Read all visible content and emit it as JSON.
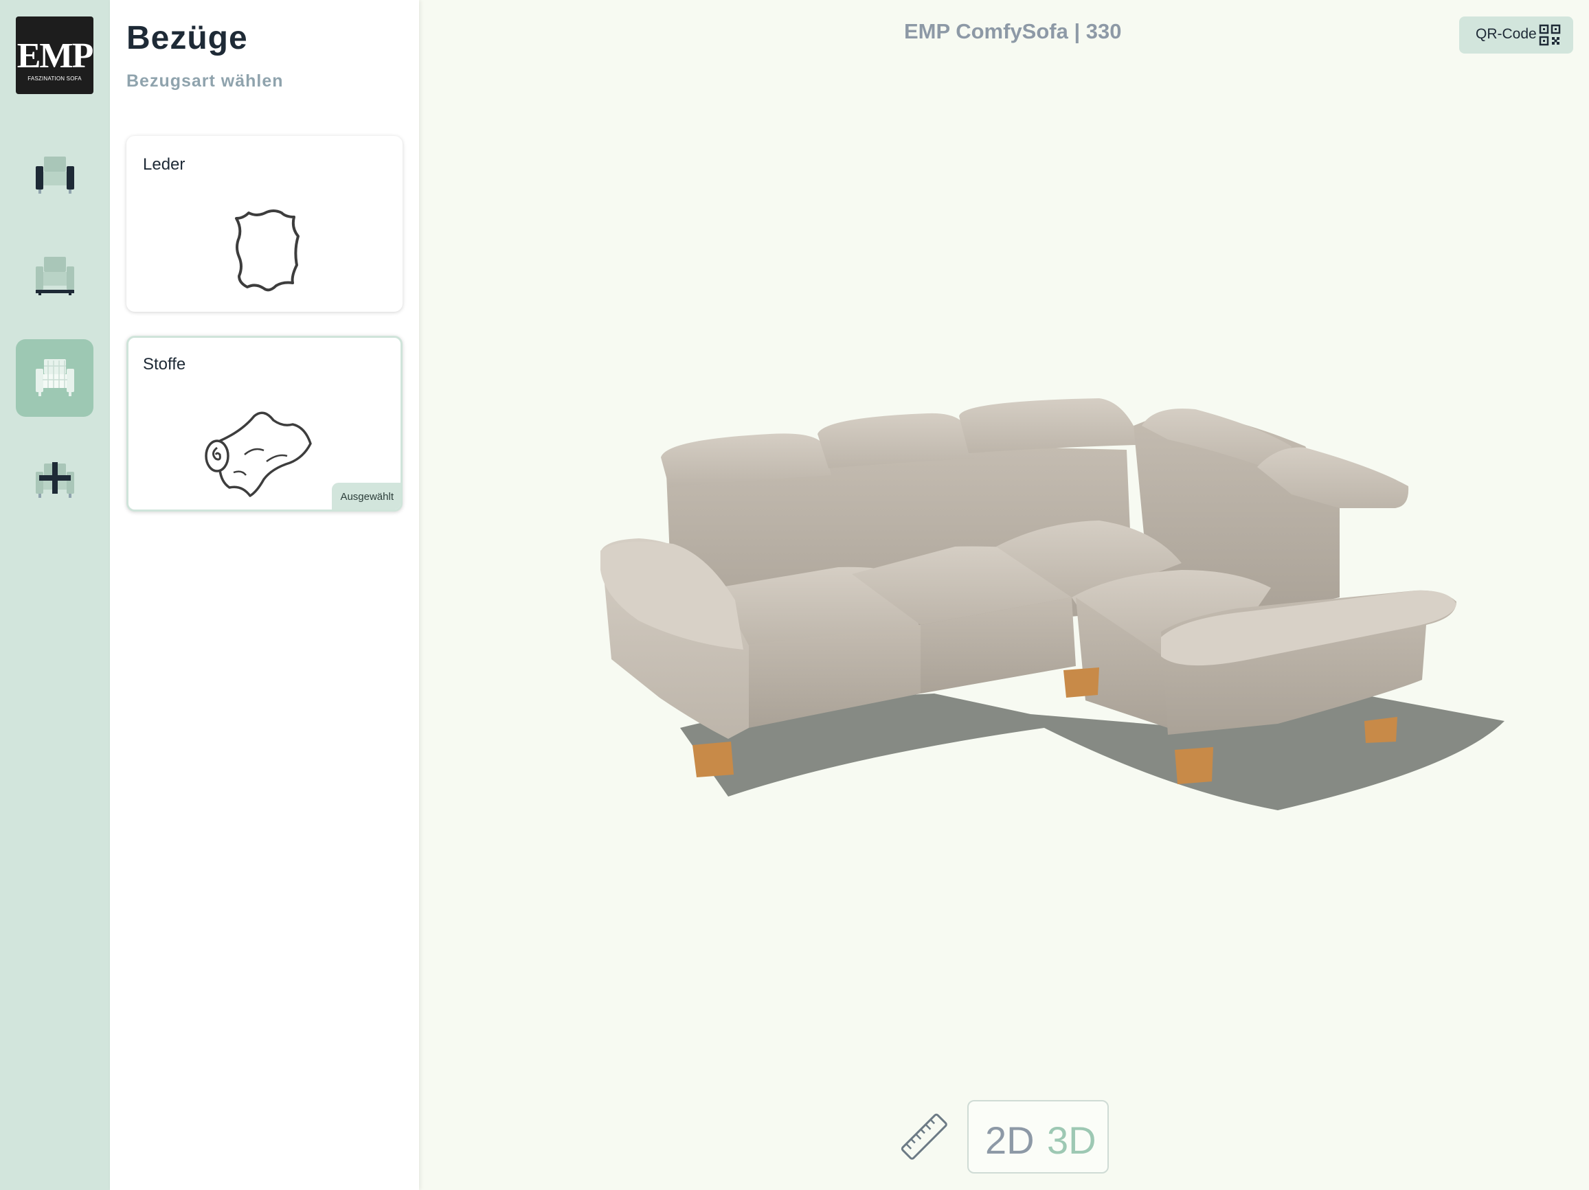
{
  "brand": {
    "name": "EMP",
    "tagline": "FASZINATION SOFA"
  },
  "rail": {
    "items": [
      {
        "id": "sofa-model",
        "icon": "sofa-dark-icon",
        "active": false
      },
      {
        "id": "sofa-function",
        "icon": "sofa-legs-icon",
        "active": false
      },
      {
        "id": "sofa-cover",
        "icon": "sofa-cover-icon",
        "active": true
      },
      {
        "id": "sofa-add",
        "icon": "sofa-add-icon",
        "active": false
      }
    ]
  },
  "panel": {
    "title": "Bezüge",
    "subtitle": "Bezugsart wählen",
    "options": [
      {
        "label": "Leder",
        "icon": "leather-hide-icon",
        "selected": false
      },
      {
        "label": "Stoffe",
        "icon": "fabric-roll-icon",
        "selected": true,
        "badge": "Ausgewählt"
      }
    ]
  },
  "header": {
    "product_title": "EMP ComfySofa | 330",
    "qr_label": "QR-Code"
  },
  "view": {
    "mode_2d": "2D",
    "mode_3d": "3D",
    "active_mode": "3D",
    "measure_icon": "ruler-icon"
  },
  "colors": {
    "rail_bg": "#d2e5dc",
    "accent": "#9dc8b3",
    "canvas_bg": "#f7faf2",
    "fabric": "#cbc3b8",
    "feet": "#c88a48"
  }
}
